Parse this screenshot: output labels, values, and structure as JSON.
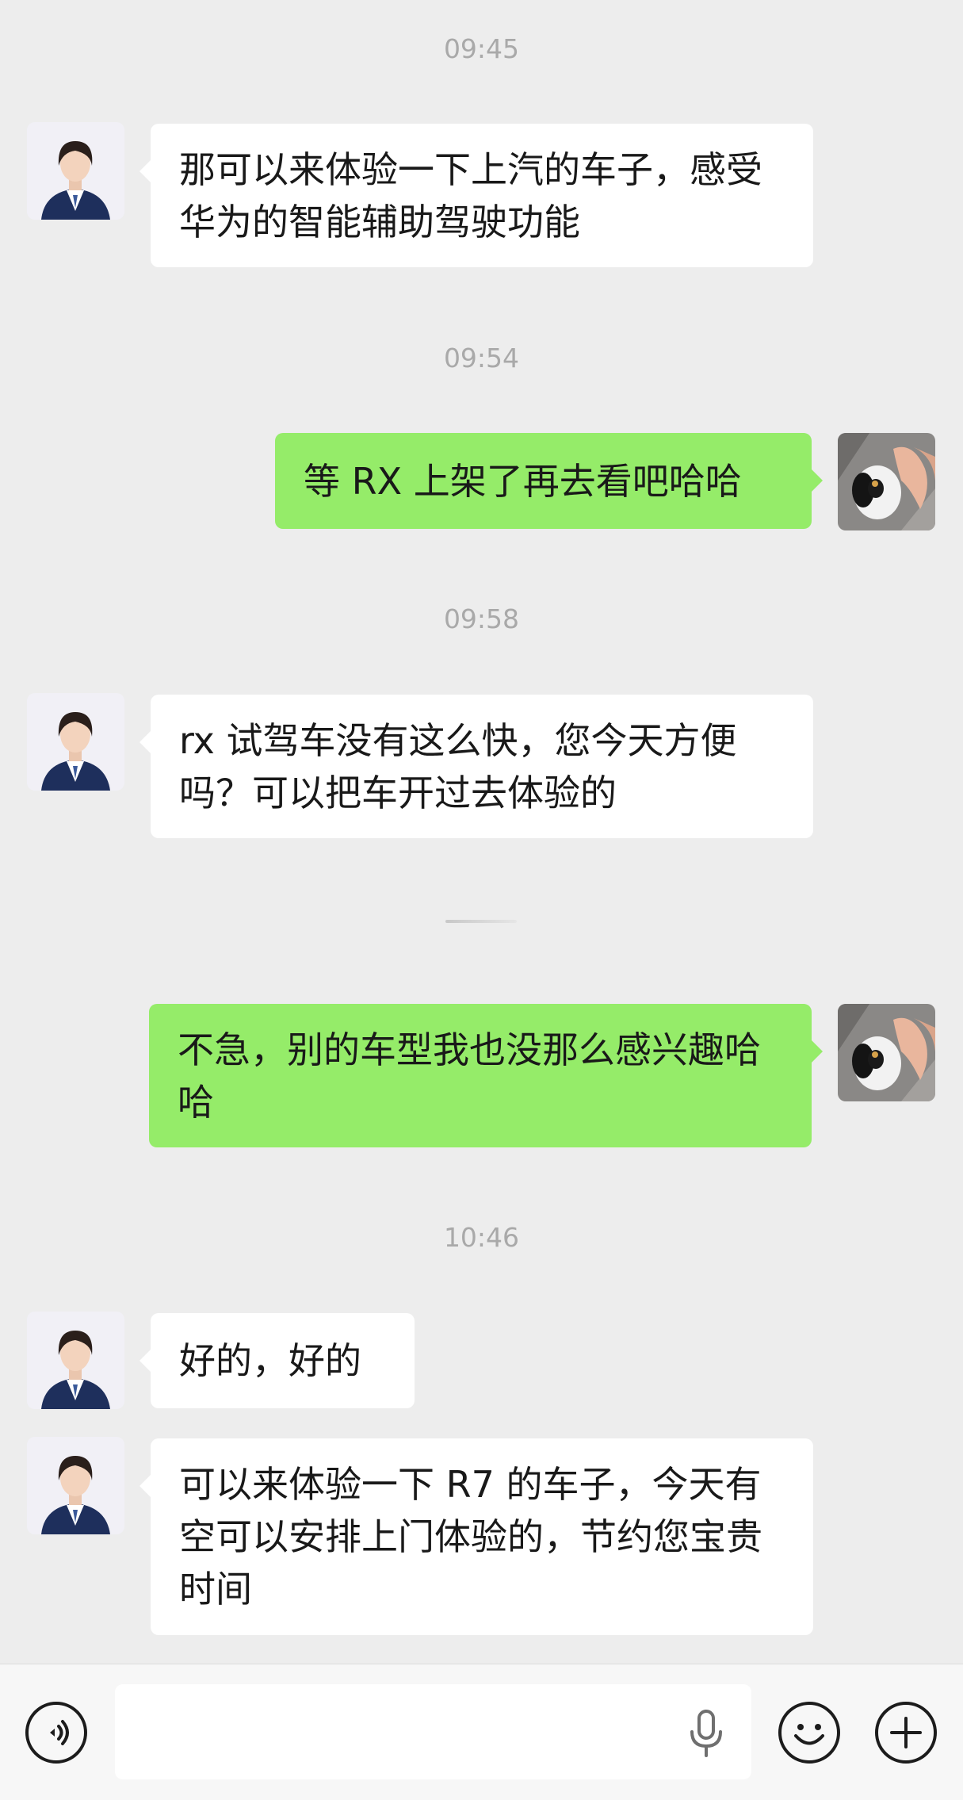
{
  "messages": [
    {
      "time": "09:45"
    },
    {
      "sender": "agent",
      "text": "那可以来体验一下上汽的车子，感受华为的智能辅助驾驶功能"
    },
    {
      "time": "09:54"
    },
    {
      "sender": "me",
      "text": "等 RX 上架了再去看吧哈哈"
    },
    {
      "time": "09:58"
    },
    {
      "sender": "agent",
      "text": "rx 试驾车没有这么快，您今天方便吗？可以把车开过去体验的"
    },
    {
      "sender": "me",
      "text": "不急，别的车型我也没那么感兴趣哈哈"
    },
    {
      "time": "10:46"
    },
    {
      "sender": "agent",
      "text": "好的，好的"
    },
    {
      "sender": "agent",
      "text": "可以来体验一下 R7 的车子，今天有空可以安排上门体验的，节约您宝贵时间"
    }
  ],
  "toolbar": {
    "voice_icon": "voice-toggle-icon",
    "input_value": "",
    "mic_icon": "microphone-icon",
    "emoji_icon": "emoji-icon",
    "more_icon": "plus-icon"
  },
  "colors": {
    "background": "#ededed",
    "my_bubble": "#95ec69",
    "their_bubble": "#ffffff",
    "timestamp": "#a9a9a9"
  }
}
